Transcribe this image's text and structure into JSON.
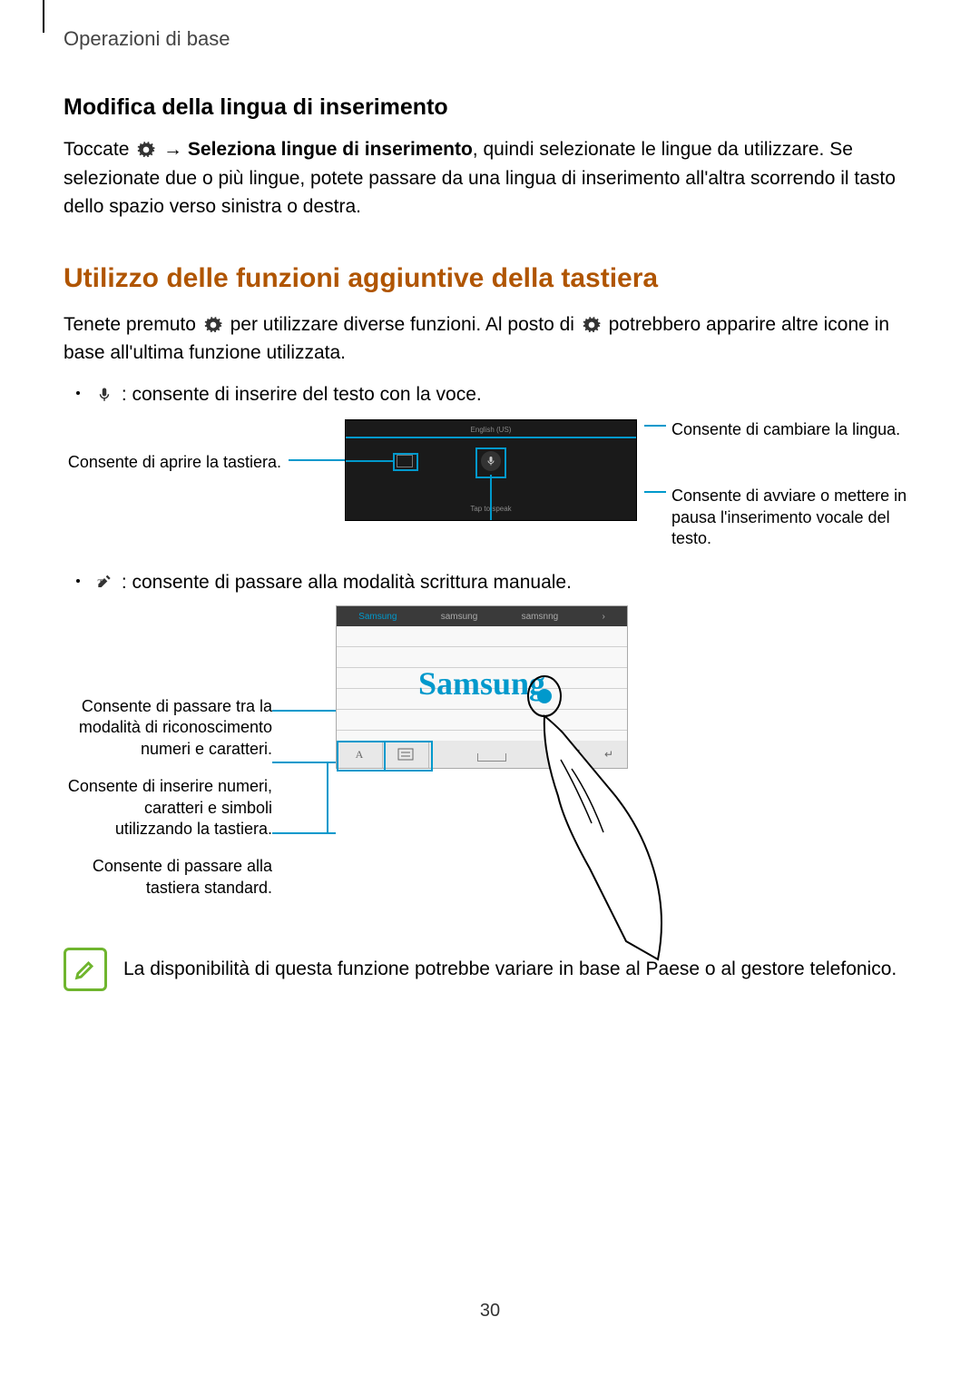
{
  "header": {
    "breadcrumb": "Operazioni di base"
  },
  "section1": {
    "title": "Modifica della lingua di inserimento",
    "para_pre": "Toccate ",
    "para_arrow": " → ",
    "para_bold": "Seleziona lingue di inserimento",
    "para_post": ", quindi selezionate le lingue da utilizzare. Se selezionate due o più lingue, potete passare da una lingua di inserimento all'altra scorrendo il tasto dello spazio verso sinistra o destra."
  },
  "section2": {
    "title": "Utilizzo delle funzioni aggiuntive della tastiera",
    "para_pre": "Tenete premuto ",
    "para_mid": " per utilizzare diverse funzioni. Al posto di ",
    "para_post": " potrebbero apparire altre icone in base all'ultima funzione utilizzata.",
    "bullet1": " : consente di inserire del testo con la voce.",
    "bullet2": " : consente di passare alla modalità scrittura manuale."
  },
  "fig1": {
    "left_label": "Consente di aprire la tastiera.",
    "right1": "Consente di cambiare la lingua.",
    "right2": "Consente di avviare o mettere in pausa l'inserimento vocale del testo.",
    "lang_indicator": "English (US)",
    "tap_label": "Tap to speak"
  },
  "fig2": {
    "left1": "Consente di passare tra la modalità di riconoscimento numeri e caratteri.",
    "left2": "Consente di inserire numeri, caratteri e simboli utilizzando la tastiera.",
    "left3": "Consente di passare alla tastiera standard.",
    "suggestions": [
      "Samsung",
      "samsung",
      "samsnng",
      "›"
    ],
    "handwritten": "Samsung",
    "btn_mode": "A",
    "btn_space": " ",
    "btn_del": "⌫",
    "btn_enter": "↵"
  },
  "note": {
    "text": "La disponibilità di questa funzione potrebbe variare in base al Paese o al gestore telefonico."
  },
  "page_number": "30"
}
